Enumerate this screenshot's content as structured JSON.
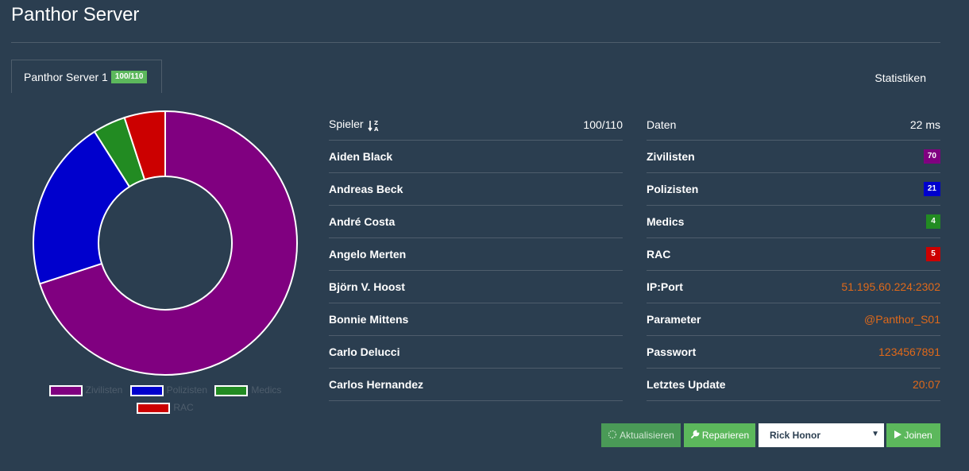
{
  "page": {
    "title": "Panthor Server"
  },
  "tabs": {
    "server": {
      "label": "Panthor Server 1",
      "badge": "100/110"
    },
    "stats": {
      "label": "Statistiken"
    }
  },
  "players_table": {
    "header_label": "Spieler",
    "header_value": "100/110",
    "players": [
      "Aiden Black",
      "Andreas Beck",
      "André Costa",
      "Angelo Merten",
      "Björn V. Hoost",
      "Bonnie Mittens",
      "Carlo Delucci",
      "Carlos Hernandez"
    ]
  },
  "info_table": {
    "header_label": "Daten",
    "header_value": "22 ms",
    "civ_label": "Zivilisten",
    "civ_value": "70",
    "cop_label": "Polizisten",
    "cop_value": "21",
    "med_label": "Medics",
    "med_value": "4",
    "rac_label": "RAC",
    "rac_value": "5",
    "ip_label": "IP:Port",
    "ip_value": "51.195.60.224:2302",
    "param_label": "Parameter",
    "param_value": "@Panthor_S01",
    "pass_label": "Passwort",
    "pass_value": "1234567891",
    "update_label": "Letztes Update",
    "update_value": "20:07"
  },
  "actions": {
    "refresh_label": "Aktualisieren",
    "repair_label": "Reparieren",
    "profile_selected": "Rick Honor",
    "join_label": "Joinen"
  },
  "colors": {
    "civ": "#800080",
    "cop": "#0000cd",
    "med": "#228b22",
    "rac": "#cc0000",
    "accent": "#df691a",
    "success": "#5cb85c"
  },
  "chart_data": {
    "type": "pie",
    "categories": [
      "Zivilisten",
      "Polizisten",
      "Medics",
      "RAC"
    ],
    "values": [
      70,
      21,
      4,
      5
    ],
    "colors": [
      "#800080",
      "#0000cd",
      "#228b22",
      "#cc0000"
    ],
    "donut": true,
    "legend": "bottom"
  }
}
